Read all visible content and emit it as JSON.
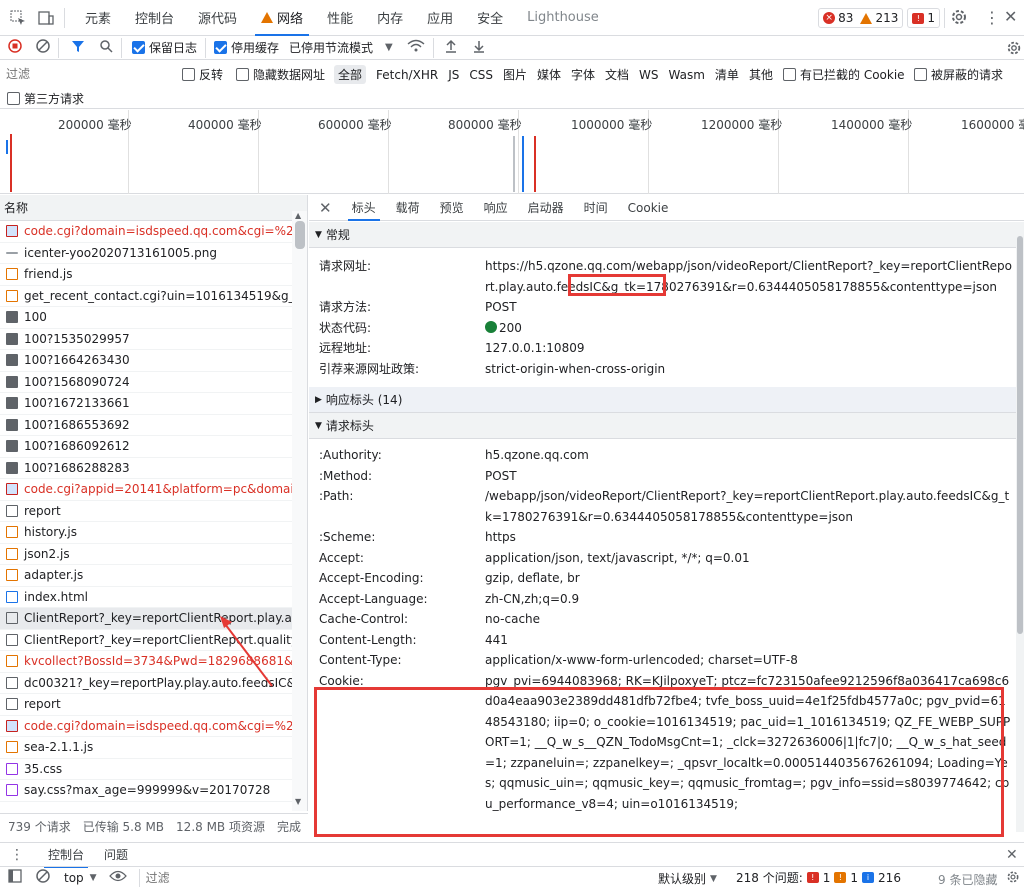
{
  "topbar": {
    "tabs": [
      "元素",
      "控制台",
      "源代码",
      "网络",
      "性能",
      "内存",
      "应用",
      "安全",
      "Lighthouse"
    ],
    "active_tab": "网络",
    "badge_errors": "83",
    "badge_warnings": "213",
    "badge_issues": "1"
  },
  "toolbar": {
    "preserve_log": "保留日志",
    "disable_cache": "停用缓存",
    "throttle": "已停用节流模式"
  },
  "filterbar": {
    "placeholder": "过滤",
    "invert": "反转",
    "hide_data_urls": "隐藏数据网址",
    "types": [
      "全部",
      "Fetch/XHR",
      "JS",
      "CSS",
      "图片",
      "媒体",
      "字体",
      "文档",
      "WS",
      "Wasm",
      "清单",
      "其他"
    ],
    "blocked_cookies": "有已拦截的 Cookie",
    "blocked_requests": "被屏蔽的请求",
    "third_party": "第三方请求"
  },
  "overview": {
    "ticks": [
      "200000 毫秒",
      "400000 毫秒",
      "600000 毫秒",
      "800000 毫秒",
      "1000000 毫秒",
      "1200000 毫秒",
      "1400000 毫秒",
      "1600000 毫秒"
    ]
  },
  "list": {
    "header": "名称",
    "items": [
      {
        "name": "code.cgi?domain=isdspeed.qq.com&cgi=%2Fc...",
        "kind": "red",
        "err": true
      },
      {
        "name": "icenter-yoo2020713161005.png",
        "kind": "dash",
        "err": false
      },
      {
        "name": "friend.js",
        "kind": "js",
        "err": false
      },
      {
        "name": "get_recent_contact.cgi?uin=1016134519&g_tk...",
        "kind": "js",
        "err": false
      },
      {
        "name": "100",
        "kind": "img",
        "err": false
      },
      {
        "name": "100?1535029957",
        "kind": "img",
        "err": false
      },
      {
        "name": "100?1664263430",
        "kind": "img",
        "err": false
      },
      {
        "name": "100?1568090724",
        "kind": "img",
        "err": false
      },
      {
        "name": "100?1672133661",
        "kind": "img",
        "err": false
      },
      {
        "name": "100?1686553692",
        "kind": "img",
        "err": false
      },
      {
        "name": "100?1686092612",
        "kind": "img",
        "err": false
      },
      {
        "name": "100?1686288283",
        "kind": "img",
        "err": false
      },
      {
        "name": "code.cgi?appid=20141&platform=pc&domain...",
        "kind": "red",
        "err": true
      },
      {
        "name": "report",
        "kind": "blank",
        "err": false
      },
      {
        "name": "history.js",
        "kind": "js",
        "err": false
      },
      {
        "name": "json2.js",
        "kind": "js",
        "err": false
      },
      {
        "name": "adapter.js",
        "kind": "js",
        "err": false
      },
      {
        "name": "index.html",
        "kind": "doc",
        "err": false
      },
      {
        "name": "ClientReport?_key=reportClientReport.play.auto...",
        "kind": "blank",
        "err": false,
        "selected": true
      },
      {
        "name": "ClientReport?_key=reportClientReport.quality.fe...",
        "kind": "blank",
        "err": false
      },
      {
        "name": "kvcollect?BossId=3734&Pwd=1829688681&_ke...",
        "kind": "js",
        "err": true
      },
      {
        "name": "dc00321?_key=reportPlay.play.auto.feedsIC&ui...",
        "kind": "blank",
        "err": false
      },
      {
        "name": "report",
        "kind": "blank",
        "err": false
      },
      {
        "name": "code.cgi?domain=isdspeed.qq.com&cgi=%2Fc...",
        "kind": "red",
        "err": true
      },
      {
        "name": "sea-2.1.1.js",
        "kind": "js",
        "err": false
      },
      {
        "name": "35.css",
        "kind": "css",
        "err": false
      },
      {
        "name": "say.css?max_age=999999&v=20170728",
        "kind": "css",
        "err": false
      }
    ]
  },
  "status": {
    "requests": "739 个请求",
    "transferred": "已传输 5.8 MB",
    "resources": "12.8 MB 项资源",
    "finish": "完成"
  },
  "detail": {
    "tabs": [
      "标头",
      "载荷",
      "预览",
      "响应",
      "启动器",
      "时间",
      "Cookie"
    ],
    "active_tab": "标头",
    "general_title": "常规",
    "general": [
      {
        "k": "请求网址:",
        "v": "https://h5.qzone.qq.com/webapp/json/videoReport/ClientReport?_key=reportClientReport.play.auto.feedsIC&g_tk=1780276391&r=0.6344405058178855&contenttype=json"
      },
      {
        "k": "请求方法:",
        "v": "POST"
      },
      {
        "k": "状态代码:",
        "v": "200"
      },
      {
        "k": "远程地址:",
        "v": "127.0.0.1:10809"
      },
      {
        "k": "引荐来源网址政策:",
        "v": "strict-origin-when-cross-origin"
      }
    ],
    "response_headers_title": "响应标头 (14)",
    "request_headers_title": "请求标头",
    "request_headers": [
      {
        "k": ":Authority:",
        "v": "h5.qzone.qq.com"
      },
      {
        "k": ":Method:",
        "v": "POST"
      },
      {
        "k": ":Path:",
        "v": "/webapp/json/videoReport/ClientReport?_key=reportClientReport.play.auto.feedsIC&g_tk=1780276391&r=0.6344405058178855&contenttype=json"
      },
      {
        "k": ":Scheme:",
        "v": "https"
      },
      {
        "k": "Accept:",
        "v": "application/json, text/javascript, */*; q=0.01"
      },
      {
        "k": "Accept-Encoding:",
        "v": "gzip, deflate, br"
      },
      {
        "k": "Accept-Language:",
        "v": "zh-CN,zh;q=0.9"
      },
      {
        "k": "Cache-Control:",
        "v": "no-cache"
      },
      {
        "k": "Content-Length:",
        "v": "441"
      },
      {
        "k": "Content-Type:",
        "v": "application/x-www-form-urlencoded; charset=UTF-8"
      },
      {
        "k": "Cookie:",
        "v": "pgv_pvi=6944083968; RK=KJilpoxyeT; ptcz=fc723150afee9212596f8a036417ca698c6d0a4eaa903e2389dd481dfb72fbe4; tvfe_boss_uuid=4e1f25fdb4577a0c; pgv_pvid=6148543180; iip=0; o_cookie=1016134519; pac_uid=1_1016134519; QZ_FE_WEBP_SUPPORT=1; __Q_w_s__QZN_TodoMsgCnt=1; _clck=3272636006|1|fc7|0; __Q_w_s_hat_seed=1; zzpaneluin=; zzpanelkey=; _qpsvr_localtk=0.0005144035676261094; Loading=Yes; qqmusic_uin=; qqmusic_key=; qqmusic_fromtag=; pgv_info=ssid=s8039774642; cpu_performance_v8=4; uin=o1016134519;"
      }
    ]
  },
  "drawer": {
    "tabs": [
      "控制台",
      "问题"
    ],
    "context": "top",
    "filter_placeholder": "过滤",
    "level": "默认级别",
    "issues": "218 个问题:",
    "err_count": "1",
    "warn_count": "1",
    "info_count": "216",
    "hidden": "9 条已隐藏"
  },
  "colors": {
    "accent": "#1a73e8",
    "error": "#d93025",
    "annotation": "#e53935"
  }
}
